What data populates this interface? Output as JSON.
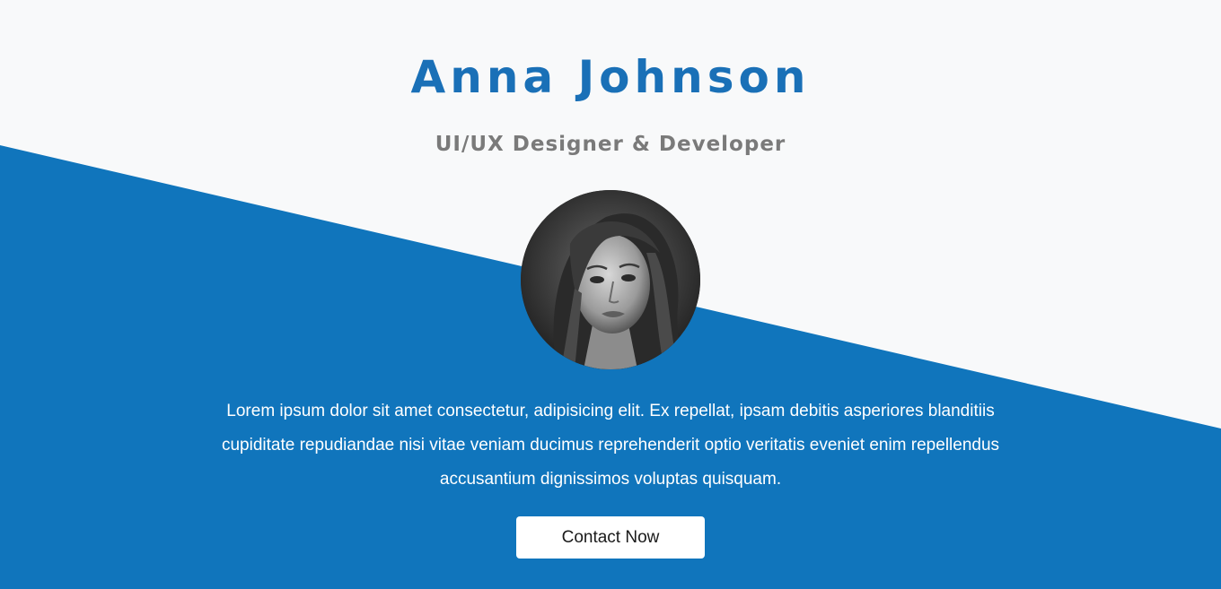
{
  "hero": {
    "name": "Anna Johnson",
    "title": "UI/UX Designer & Developer",
    "bio": "Lorem ipsum dolor sit amet consectetur, adipisicing elit. Ex repellat, ipsam debitis asperiores blanditiis cupiditate repudiandae nisi vitae veniam ducimus reprehenderit optio veritatis eveniet enim repellendus accusantium dignissimos voluptas quisquam.",
    "button_label": "Contact Now"
  },
  "colors": {
    "accent_blue": "#1075bc",
    "name_blue": "#1a70b7",
    "background": "#f8f9fa",
    "subtitle_gray": "#7a7a7a",
    "button_bg": "#ffffff"
  }
}
